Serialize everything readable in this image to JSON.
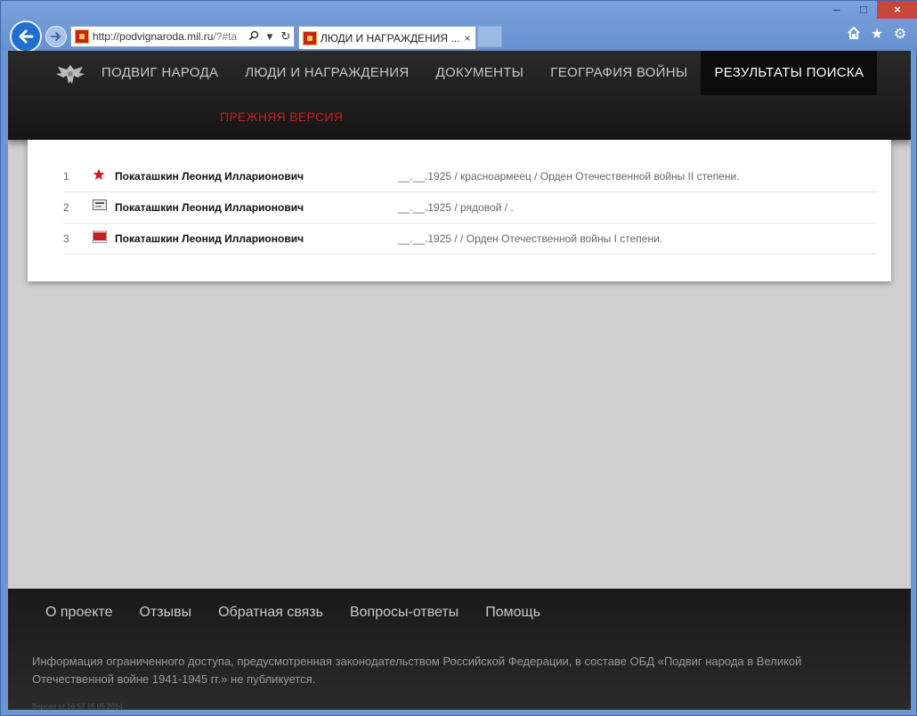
{
  "browser": {
    "url_host": "http://podvignaroda.mil.ru",
    "url_rest": "/?#ta",
    "tab_title": "ЛЮДИ И НАГРАЖДЕНИЯ ...",
    "tab_close": "×",
    "window_controls": {
      "minimize": "–",
      "maximize": "□",
      "close": "×"
    },
    "icons": [
      "back-arrow-icon",
      "forward-arrow-icon",
      "search-icon",
      "refresh-icon",
      "home-icon",
      "favorites-star-icon",
      "settings-gear-icon"
    ]
  },
  "header": {
    "menu": [
      {
        "label": "ПОДВИГ НАРОДА",
        "active": false
      },
      {
        "label": "ЛЮДИ И НАГРАЖДЕНИЯ",
        "active": false
      },
      {
        "label": "ДОКУМЕНТЫ",
        "active": false
      },
      {
        "label": "ГЕОГРАФИЯ ВОЙНЫ",
        "active": false
      },
      {
        "label": "РЕЗУЛЬТАТЫ ПОИСКА",
        "active": true
      }
    ],
    "old_version": "ПРЕЖНЯЯ ВЕРСИЯ"
  },
  "results": [
    {
      "num": "1",
      "icon": "red-star-icon",
      "name": "Покаташкин Леонид Илларионович",
      "info": "__.__.1925 /  красноармеец /  Орден Отечественной войны II степени."
    },
    {
      "num": "2",
      "icon": "document-card-icon",
      "name": "Покаташкин Леонид Илларионович",
      "info": "__.__.1925 /  рядовой /  ."
    },
    {
      "num": "3",
      "icon": "anniversary-40-icon",
      "name": "Покаташкин Леонид Илларионович",
      "info": "__.__.1925 /   /  Орден Отечественной войны I степени."
    }
  ],
  "footer": {
    "links": [
      "О проекте",
      "Отзывы",
      "Обратная связь",
      "Вопросы-ответы",
      "Помощь"
    ],
    "note": "Информация ограниченного доступа, предусмотренная законодательством Российской Федерации, в составе ОБД «Подвиг народа в Великой Отечественной войне 1941-1945 гг.» не публикуется.",
    "version": "Версия от 16:57 15.05.2014"
  },
  "colors": {
    "accent_red": "#c81e1e",
    "header_bg": "#1e1e1e",
    "page_bg": "#cfcfcf",
    "browser_blue": "#6b95d3"
  }
}
